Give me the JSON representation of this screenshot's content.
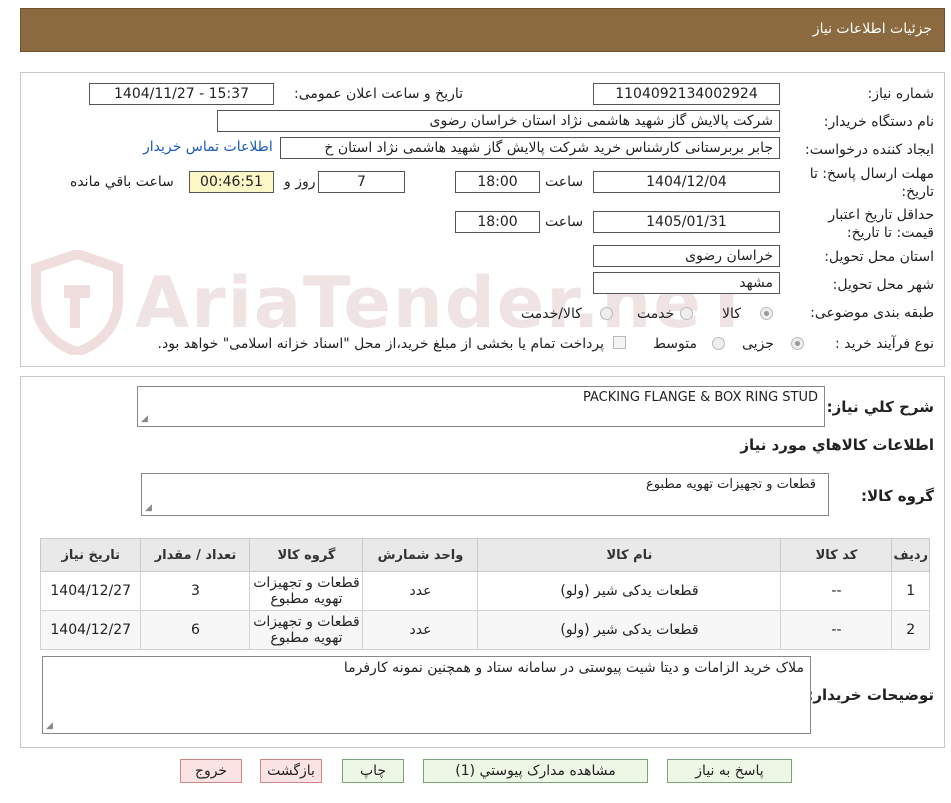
{
  "header": {
    "title": "جزئیات اطلاعات نیاز"
  },
  "watermark": "AriaTender.neT",
  "fields": {
    "need_number_label": "شماره نیاز:",
    "need_number": "1104092134002924",
    "announce_label": "تاریخ و ساعت اعلان عمومی:",
    "announce_value": "1404/11/27 - 15:37",
    "buyer_org_label": "نام دستگاه خریدار:",
    "buyer_org": "شرکت پالایش گاز شهید هاشمی نژاد   استان خراسان رضوی",
    "creator_label": "ایجاد کننده درخواست:",
    "creator": "جابر بربرستانی کارشناس خرید شرکت پالایش گاز شهید هاشمی نژاد   استان خ",
    "contact_link": "اطلاعات تماس خریدار",
    "deadline_label_1": "مهلت ارسال پاسخ: تا",
    "deadline_label_2": "تاریخ:",
    "deadline_date": "1404/12/04",
    "hour_label": "ساعت",
    "deadline_hour": "18:00",
    "days_value": "7",
    "days_label": "روز و",
    "remaining_time": "00:46:51",
    "remaining_label": "ساعت باقي مانده",
    "validity_label_1": "حداقل تاریخ اعتبار",
    "validity_label_2": "قیمت: تا تاریخ:",
    "validity_date": "1405/01/31",
    "validity_hour": "18:00",
    "province_label": "استان محل تحویل:",
    "province": "خراسان رضوی",
    "city_label": "شهر محل تحویل:",
    "city": "مشهد",
    "category_label": "طبقه بندی موضوعی:",
    "category_options": [
      "کالا",
      "خدمت",
      "کالا/خدمت"
    ],
    "process_label": "نوع فرآیند خرید :",
    "process_options": [
      "جزیی",
      "متوسط"
    ],
    "payment_note": "پرداخت تمام یا بخشی از مبلغ خرید،از محل \"اسناد خزانه اسلامی\" خواهد بود."
  },
  "details": {
    "summary_label": "شرح کلي نیاز:",
    "summary": "PACKING FLANGE & BOX RING STUD",
    "goods_info_title": "اطلاعات کالاهاي مورد نیاز",
    "goods_group_label": "گروه کالا:",
    "goods_group": "قطعات و تجهیزات تهویه مطبوع",
    "table": {
      "headers": [
        "ردیف",
        "کد کالا",
        "نام کالا",
        "واحد شمارش",
        "گروه کالا",
        "تعداد / مقدار",
        "تاریخ نیاز"
      ],
      "rows": [
        [
          "1",
          "--",
          "قطعات یدکی شیر (ولو)",
          "عدد",
          "قطعات و تجهیزات تهویه مطبوع",
          "3",
          "1404/12/27"
        ],
        [
          "2",
          "--",
          "قطعات یدکی شیر (ولو)",
          "عدد",
          "قطعات و تجهیزات تهویه مطبوع",
          "6",
          "1404/12/27"
        ]
      ]
    },
    "buyer_notes_label": "توضیحات خریدار:",
    "buyer_notes": "ملاک خرید الزامات و دیتا شیت پیوستی در سامانه ستاد و همچنین نمونه کارفرما"
  },
  "buttons": {
    "reply": "پاسخ به نیاز",
    "attachments": "مشاهده مدارک پیوستي (1)",
    "print": "چاپ",
    "back": "بازگشت",
    "exit": "خروج"
  }
}
